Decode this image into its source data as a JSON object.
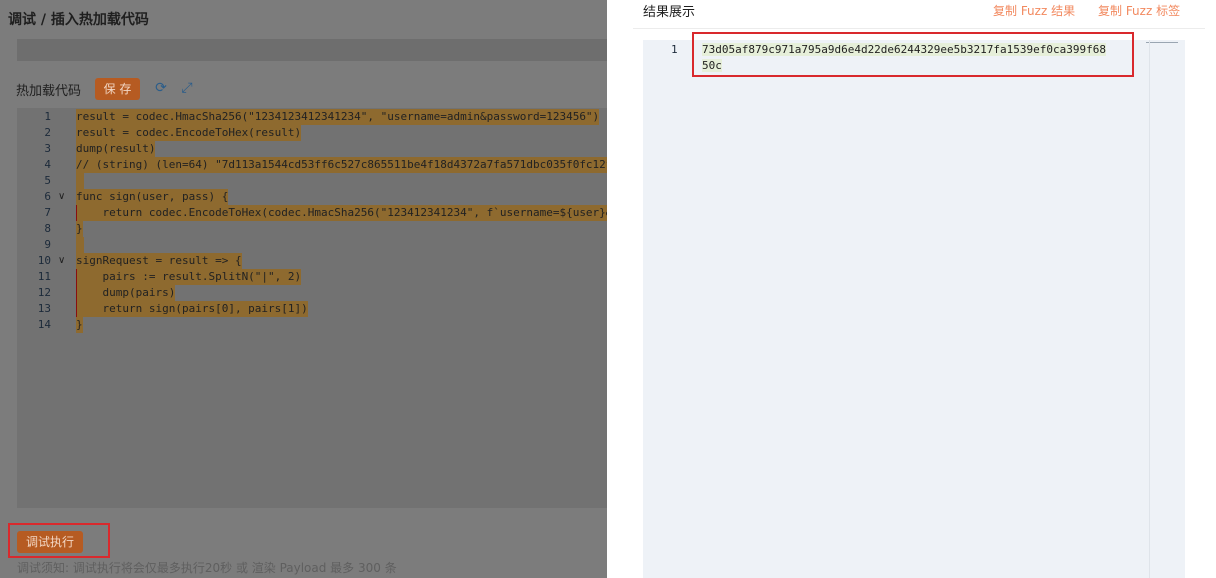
{
  "left": {
    "title": "调试 / 插入热加载代码",
    "hot_label": "热加载代码",
    "save_label": "保 存",
    "code_lines": [
      "result = codec.HmacSha256(\"1234123412341234\", \"username=admin&password=123456\")",
      "result = codec.EncodeToHex(result)",
      "dump(result)",
      "// (string) (len=64) \"7d113a1544cd53ff6c527c865511be4f18d4372a7fa571dbc035f0fc12f",
      "",
      "func sign(user, pass) {",
      "    return codec.EncodeToHex(codec.HmacSha256(\"123412341234\", f`username=${user}&",
      "}",
      "",
      "signRequest = result => {",
      "    pairs := result.SplitN(\"|\", 2)",
      "    dump(pairs)",
      "    return sign(pairs[0], pairs[1])",
      "}"
    ],
    "line_numbers": [
      "1",
      "2",
      "3",
      "4",
      "5",
      "6",
      "7",
      "8",
      "9",
      "10",
      "11",
      "12",
      "13",
      "14"
    ],
    "run_label": "调试执行",
    "note": "调试须知: 调试执行将会仅最多执行20秒 或 渲染 Payload 最多 300 条"
  },
  "right": {
    "title": "结果展示",
    "copy_fuzz_result": "复制 Fuzz 结果",
    "copy_fuzz_tag": "复制 Fuzz 标签",
    "line_number": "1",
    "result_text": "73d05af879c971a795a9d6e4d22de6244329ee5b3217fa1539ef0ca399f6850c"
  },
  "colors": {
    "accent": "#b65b22",
    "link": "#f2895f",
    "highlight_box": "#d9292d"
  }
}
